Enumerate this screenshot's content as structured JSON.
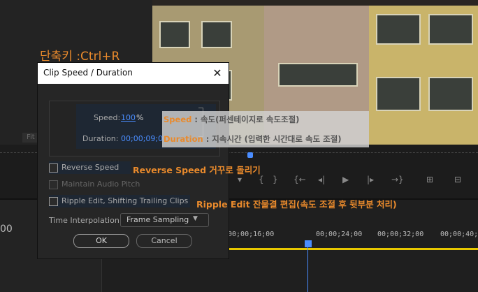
{
  "annotation": {
    "shortcut": "단축키 :Ctrl+R",
    "speed_key": "Speed",
    "speed_desc": " : 속도(퍼센테이지로 속도조절)",
    "duration_key": "Duration",
    "duration_desc": " : 지속시간 (입력한 시간대로 속도 조절)",
    "reverse_key": "Reverse Speed",
    "reverse_desc": " 거꾸로 돌리기",
    "ripple_key": "Ripple Edit",
    "ripple_desc": " 잔물결 편집(속도 조절 후 뒷부분 처리)"
  },
  "dialog": {
    "title": "Clip Speed / Duration",
    "close_glyph": "✕",
    "speed_label": "Speed:",
    "speed_value": "100",
    "speed_unit": "%",
    "duration_label": "Duration:",
    "duration_value": "00;00;09;01",
    "reverse_label": "Reverse Speed",
    "maintain_label": "Maintain Audio Pitch",
    "ripple_label": "Ripple Edit, Shifting Trailing Clips",
    "interp_label": "Time Interpolation:",
    "interp_value": "Frame Sampling",
    "ok_label": "OK",
    "cancel_label": "Cancel"
  },
  "background": {
    "fit_label": "Fit",
    "timecodes": [
      "00;00;16;00",
      "00;00;24;00",
      "00;00;32;00",
      "00;00;40;0"
    ],
    "left_num": "00",
    "toolbar_icons": [
      "marker-icon",
      "mark-in-icon",
      "mark-out-icon",
      "go-to-in-icon",
      "step-back-icon",
      "play-icon",
      "step-forward-icon",
      "go-to-out-icon",
      "insert-icon",
      "overwrite-icon"
    ]
  }
}
